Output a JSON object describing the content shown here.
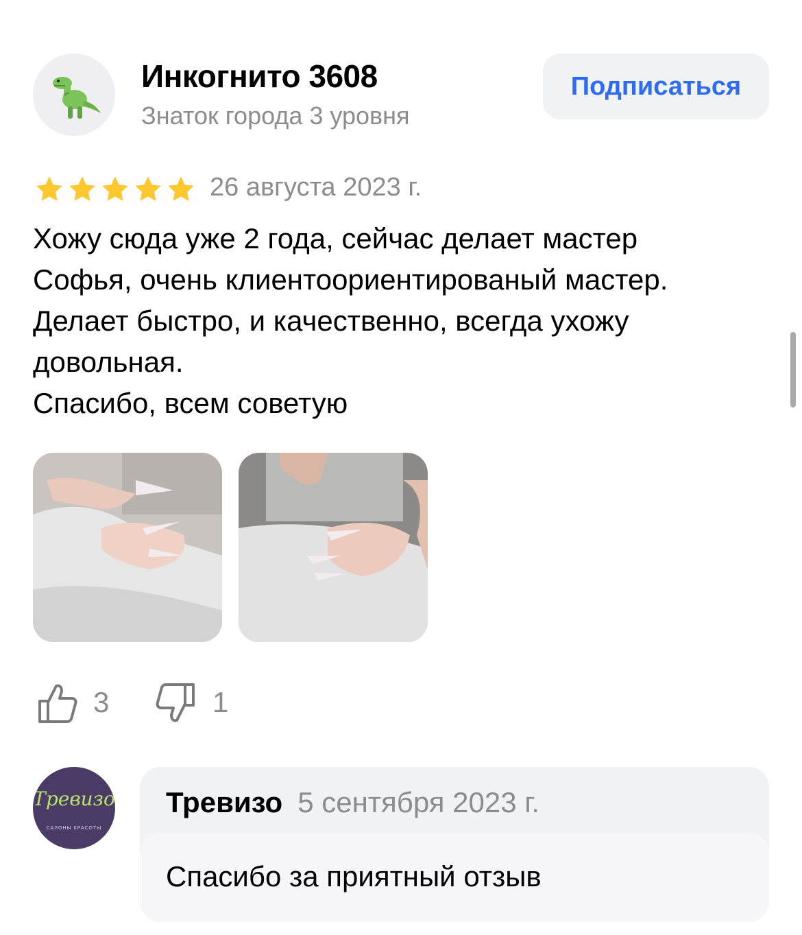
{
  "author": {
    "name": "Инкогнито 3608",
    "level": "Знаток города 3 уровня",
    "avatar_icon": "dinosaur-icon"
  },
  "subscribe_label": "Подписаться",
  "review": {
    "rating": 5,
    "date": "26 августа 2023 г.",
    "lines": [
      "Хожу сюда уже 2 года, сейчас делает мастер",
      "Софья, очень клиентоориентированый мастер.",
      "Делает быстро, и качественно, всегда ухожу",
      "довольная.",
      "Спасибо, всем советую"
    ]
  },
  "reactions": {
    "likes": "3",
    "dislikes": "1"
  },
  "reply": {
    "org_logo_text": "Тревизо",
    "org_logo_sub": "САЛОНЫ КРАСОТЫ",
    "name": "Тревизо",
    "date": "5 сентября 2023 г.",
    "text": "Спасибо за приятный отзыв"
  },
  "colors": {
    "accent": "#2f6bef",
    "star": "#fcc82f",
    "muted": "#8c8c8c"
  }
}
